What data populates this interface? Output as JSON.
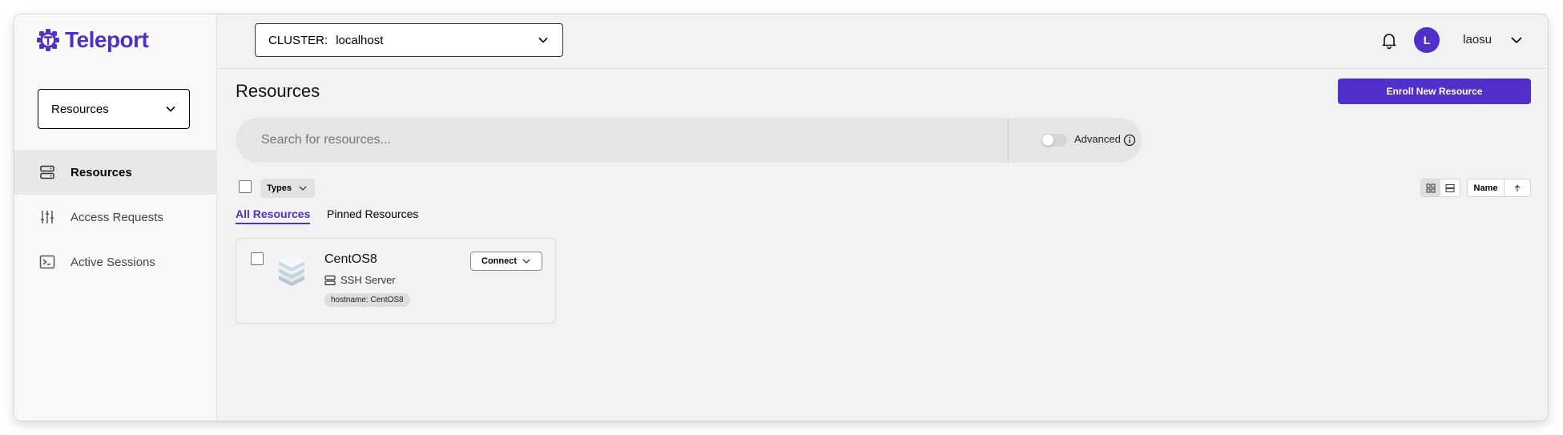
{
  "app": {
    "logo_text": "Teleport",
    "brand_color": "#512fc9"
  },
  "sidebar": {
    "selector_label": "Resources",
    "items": [
      {
        "label": "Resources",
        "icon": "server-icon",
        "active": true
      },
      {
        "label": "Access Requests",
        "icon": "sliders-icon",
        "active": false
      },
      {
        "label": "Active Sessions",
        "icon": "terminal-icon",
        "active": false
      }
    ]
  },
  "topbar": {
    "cluster_label": "CLUSTER:",
    "cluster_value": "localhost",
    "user_initial": "L",
    "username": "laosu"
  },
  "main": {
    "title": "Resources",
    "enroll_button": "Enroll New Resource",
    "search_placeholder": "Search for resources...",
    "advanced_label": "Advanced",
    "types_button": "Types",
    "sort_field": "Name",
    "tabs": [
      {
        "label": "All Resources",
        "active": true
      },
      {
        "label": "Pinned Resources",
        "active": false
      }
    ]
  },
  "resources": [
    {
      "name": "CentOS8",
      "type": "SSH Server",
      "labels": [
        "hostname: CentOS8"
      ],
      "action": "Connect"
    }
  ]
}
